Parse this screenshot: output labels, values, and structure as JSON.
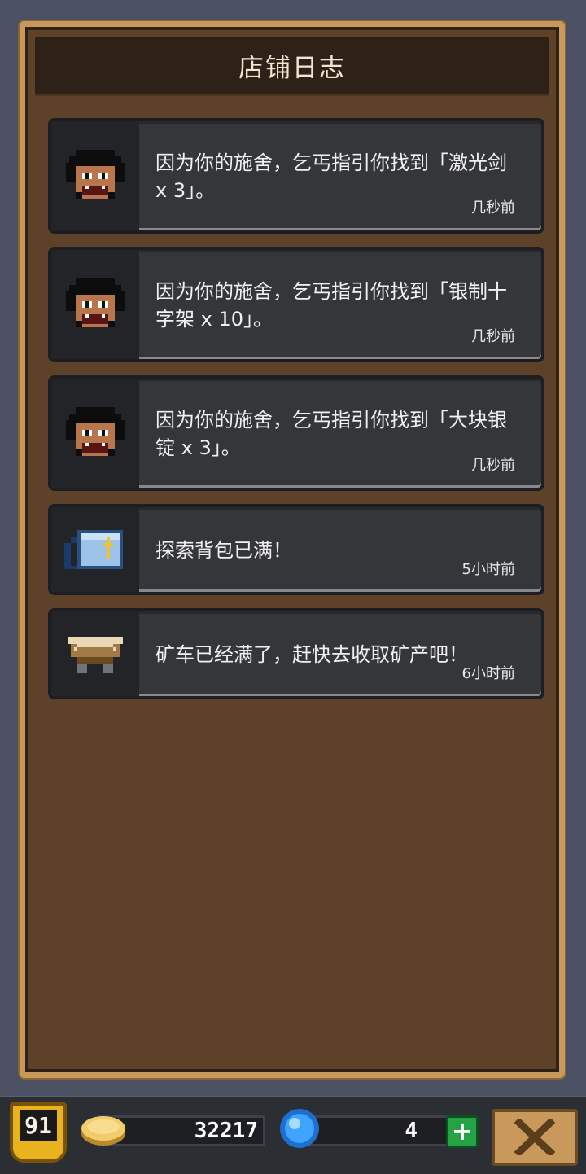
{
  "panel": {
    "title": "店铺日志"
  },
  "log": [
    {
      "icon": "beggar-icon",
      "message": "因为你的施舍，乞丐指引你找到「激光剑 x 3」。",
      "time": "几秒前"
    },
    {
      "icon": "beggar-icon",
      "message": "因为你的施舍，乞丐指引你找到「银制十字架 x 10」。",
      "time": "几秒前"
    },
    {
      "icon": "beggar-icon",
      "message": "因为你的施舍，乞丐指引你找到「大块银锭 x 3」。",
      "time": "几秒前"
    },
    {
      "icon": "backpack-icon",
      "message": "探索背包已满！",
      "time": "5小时前"
    },
    {
      "icon": "minecart-icon",
      "message": "矿车已经满了，赶快去收取矿产吧！",
      "time": "6小时前"
    }
  ],
  "status_bar": {
    "level": "91",
    "gold": "32217",
    "gems": "4",
    "add_gems_icon": "plus-icon",
    "close_icon": "close-icon"
  },
  "colors": {
    "panel_frame": "#c8995b",
    "panel_bg": "#5e4129",
    "header_bg": "#2e2117",
    "item_bg": "#343639",
    "level_badge": "#e9b31d",
    "plus_green": "#25a244"
  }
}
